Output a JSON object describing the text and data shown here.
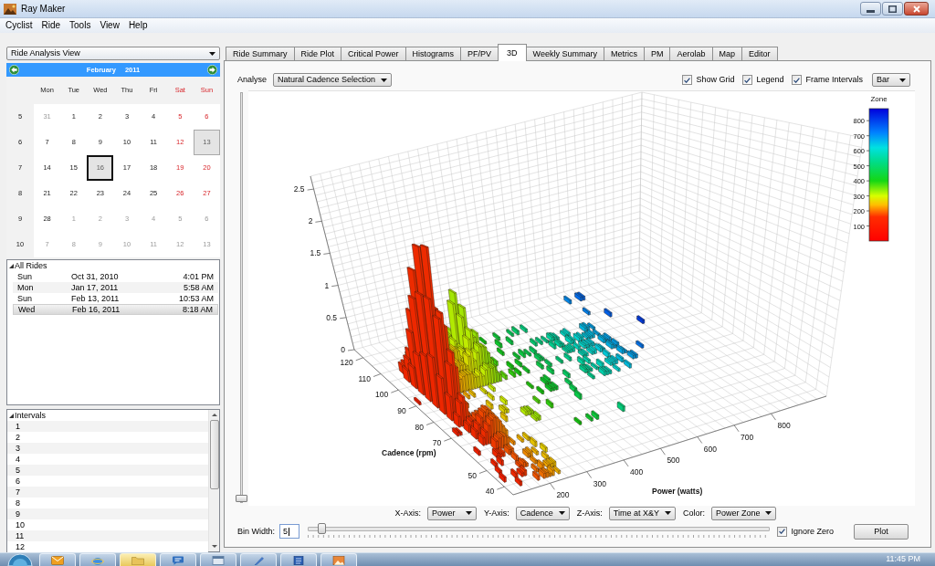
{
  "window": {
    "title": "Ray Maker"
  },
  "menu": [
    "Cyclist",
    "Ride",
    "Tools",
    "View",
    "Help"
  ],
  "sidebar": {
    "view_select": "Ride Analysis View",
    "calendar": {
      "month": "February",
      "year": "2011",
      "weekdays": [
        {
          "label": "Mon",
          "weekend": false
        },
        {
          "label": "Tue",
          "weekend": false
        },
        {
          "label": "Wed",
          "weekend": false
        },
        {
          "label": "Thu",
          "weekend": false
        },
        {
          "label": "Fri",
          "weekend": false
        },
        {
          "label": "Sat",
          "weekend": true
        },
        {
          "label": "Sun",
          "weekend": true
        }
      ],
      "weeks": [
        {
          "number": "5",
          "days": [
            {
              "day": "31",
              "in_month": false,
              "has_ride": false,
              "selected": false
            },
            {
              "day": "1",
              "in_month": true,
              "has_ride": false,
              "selected": false
            },
            {
              "day": "2",
              "in_month": true,
              "has_ride": false,
              "selected": false
            },
            {
              "day": "3",
              "in_month": true,
              "has_ride": false,
              "selected": false
            },
            {
              "day": "4",
              "in_month": true,
              "has_ride": false,
              "selected": false
            },
            {
              "day": "5",
              "in_month": true,
              "has_ride": false,
              "selected": false
            },
            {
              "day": "6",
              "in_month": true,
              "has_ride": false,
              "selected": false
            }
          ]
        },
        {
          "number": "6",
          "days": [
            {
              "day": "7",
              "in_month": true,
              "has_ride": false,
              "selected": false
            },
            {
              "day": "8",
              "in_month": true,
              "has_ride": false,
              "selected": false
            },
            {
              "day": "9",
              "in_month": true,
              "has_ride": false,
              "selected": false
            },
            {
              "day": "10",
              "in_month": true,
              "has_ride": false,
              "selected": false
            },
            {
              "day": "11",
              "in_month": true,
              "has_ride": false,
              "selected": false
            },
            {
              "day": "12",
              "in_month": true,
              "has_ride": false,
              "selected": false
            },
            {
              "day": "13",
              "in_month": true,
              "has_ride": true,
              "selected": false
            }
          ]
        },
        {
          "number": "7",
          "days": [
            {
              "day": "14",
              "in_month": true,
              "has_ride": false,
              "selected": false
            },
            {
              "day": "15",
              "in_month": true,
              "has_ride": false,
              "selected": false
            },
            {
              "day": "16",
              "in_month": true,
              "has_ride": true,
              "selected": true
            },
            {
              "day": "17",
              "in_month": true,
              "has_ride": false,
              "selected": false
            },
            {
              "day": "18",
              "in_month": true,
              "has_ride": false,
              "selected": false
            },
            {
              "day": "19",
              "in_month": true,
              "has_ride": false,
              "selected": false
            },
            {
              "day": "20",
              "in_month": true,
              "has_ride": false,
              "selected": false
            }
          ]
        },
        {
          "number": "8",
          "days": [
            {
              "day": "21",
              "in_month": true,
              "has_ride": false,
              "selected": false
            },
            {
              "day": "22",
              "in_month": true,
              "has_ride": false,
              "selected": false
            },
            {
              "day": "23",
              "in_month": true,
              "has_ride": false,
              "selected": false
            },
            {
              "day": "24",
              "in_month": true,
              "has_ride": false,
              "selected": false
            },
            {
              "day": "25",
              "in_month": true,
              "has_ride": false,
              "selected": false
            },
            {
              "day": "26",
              "in_month": true,
              "has_ride": false,
              "selected": false
            },
            {
              "day": "27",
              "in_month": true,
              "has_ride": false,
              "selected": false
            }
          ]
        },
        {
          "number": "9",
          "days": [
            {
              "day": "28",
              "in_month": true,
              "has_ride": false,
              "selected": false
            },
            {
              "day": "1",
              "in_month": false,
              "has_ride": false,
              "selected": false
            },
            {
              "day": "2",
              "in_month": false,
              "has_ride": false,
              "selected": false
            },
            {
              "day": "3",
              "in_month": false,
              "has_ride": false,
              "selected": false
            },
            {
              "day": "4",
              "in_month": false,
              "has_ride": false,
              "selected": false
            },
            {
              "day": "5",
              "in_month": false,
              "has_ride": false,
              "selected": false
            },
            {
              "day": "6",
              "in_month": false,
              "has_ride": false,
              "selected": false
            }
          ]
        },
        {
          "number": "10",
          "days": [
            {
              "day": "7",
              "in_month": false,
              "has_ride": false,
              "selected": false
            },
            {
              "day": "8",
              "in_month": false,
              "has_ride": false,
              "selected": false
            },
            {
              "day": "9",
              "in_month": false,
              "has_ride": false,
              "selected": false
            },
            {
              "day": "10",
              "in_month": false,
              "has_ride": false,
              "selected": false
            },
            {
              "day": "11",
              "in_month": false,
              "has_ride": false,
              "selected": false
            },
            {
              "day": "12",
              "in_month": false,
              "has_ride": false,
              "selected": false
            },
            {
              "day": "13",
              "in_month": false,
              "has_ride": false,
              "selected": false
            }
          ]
        }
      ]
    },
    "rides": {
      "title": "All Rides",
      "expanded": true,
      "rows": [
        {
          "day": "Sun",
          "date": "Oct 31, 2010",
          "time": "4:01 PM",
          "selected": false
        },
        {
          "day": "Mon",
          "date": "Jan 17, 2011",
          "time": "5:58 AM",
          "selected": false
        },
        {
          "day": "Sun",
          "date": "Feb 13, 2011",
          "time": "10:53 AM",
          "selected": false
        },
        {
          "day": "Wed",
          "date": "Feb 16, 2011",
          "time": "8:18 AM",
          "selected": true
        }
      ]
    },
    "intervals": {
      "title": "Intervals",
      "expanded": true,
      "rows": [
        "1",
        "2",
        "3",
        "4",
        "5",
        "6",
        "7",
        "8",
        "9",
        "10",
        "11",
        "12"
      ]
    }
  },
  "tabs": [
    {
      "label": "Ride Summary",
      "selected": false
    },
    {
      "label": "Ride Plot",
      "selected": false
    },
    {
      "label": "Critical Power",
      "selected": false
    },
    {
      "label": "Histograms",
      "selected": false
    },
    {
      "label": "PF/PV",
      "selected": false
    },
    {
      "label": "3D",
      "selected": true
    },
    {
      "label": "Weekly Summary",
      "selected": false
    },
    {
      "label": "Metrics",
      "selected": false
    },
    {
      "label": "PM",
      "selected": false
    },
    {
      "label": "Aerolab",
      "selected": false
    },
    {
      "label": "Map",
      "selected": false
    },
    {
      "label": "Editor",
      "selected": false
    }
  ],
  "analysis": {
    "label": "Analyse",
    "value": "Natural Cadence Selection",
    "options": [
      {
        "label": "Show Grid",
        "checked": true
      },
      {
        "label": "Legend",
        "checked": true
      },
      {
        "label": "Frame Intervals",
        "checked": true
      }
    ],
    "chart_style": "Bar"
  },
  "plot": {
    "height_slider": {
      "level": 0
    },
    "z_ticks": [
      "2.5",
      "2",
      "1.5",
      "1",
      "0.5",
      "0"
    ],
    "cadence_label": "Cadence (rpm)",
    "cadence_ticks": [
      "120",
      "110",
      "100",
      "90",
      "80",
      "70",
      "50",
      "40"
    ],
    "power_label": "Power (watts)",
    "power_ticks": [
      "200",
      "300",
      "400",
      "500",
      "600",
      "700",
      "800"
    ],
    "legend": {
      "title": "Zone",
      "ticks": [
        "800",
        "700",
        "600",
        "500",
        "400",
        "300",
        "200",
        "100"
      ]
    }
  },
  "axis_selectors": [
    {
      "label": "X-Axis:",
      "value": "Power"
    },
    {
      "label": "Y-Axis:",
      "value": "Cadence"
    },
    {
      "label": "Z-Axis:",
      "value": "Time at X&Y"
    },
    {
      "label": "Color:",
      "value": "Power Zone"
    }
  ],
  "bin_width": {
    "label": "Bin Width:",
    "value": "5",
    "level": 0.02
  },
  "ignore_zero": {
    "label": "Ignore Zero",
    "checked": true
  },
  "plot_button": "Plot",
  "taskbar": {
    "buttons": [
      {
        "active": false
      },
      {
        "active": false
      },
      {
        "active": true
      },
      {
        "active": false
      },
      {
        "active": false
      },
      {
        "active": false
      },
      {
        "active": false
      },
      {
        "active": false
      }
    ],
    "clock": "11:45 PM"
  }
}
